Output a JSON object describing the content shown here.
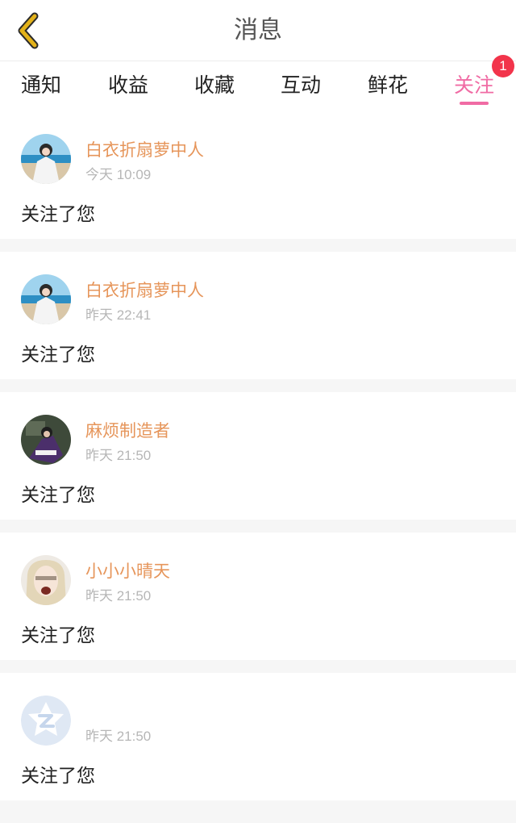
{
  "header": {
    "title": "消息",
    "back_icon": "chevron-left-icon",
    "back_color": "#e3b21a"
  },
  "tabs": [
    {
      "label": "通知"
    },
    {
      "label": "收益"
    },
    {
      "label": "收藏"
    },
    {
      "label": "互动"
    },
    {
      "label": "鲜花"
    },
    {
      "label": "关注",
      "active": true,
      "badge": "1"
    }
  ],
  "colors": {
    "accent": "#f06ba4",
    "name": "#e6955a",
    "badge": "#f2344b"
  },
  "messages": [
    {
      "name": "白衣折扇萝中人",
      "time": "今天 10:09",
      "text": "关注了您"
    },
    {
      "name": "白衣折扇萝中人",
      "time": "昨天 22:41",
      "text": "关注了您"
    },
    {
      "name": "麻烦制造者",
      "time": "昨天 21:50",
      "text": "关注了您"
    },
    {
      "name": "小小小晴天",
      "time": "昨天 21:50",
      "text": "关注了您"
    },
    {
      "name": "",
      "time": "昨天 21:50",
      "text": "关注了您"
    }
  ]
}
